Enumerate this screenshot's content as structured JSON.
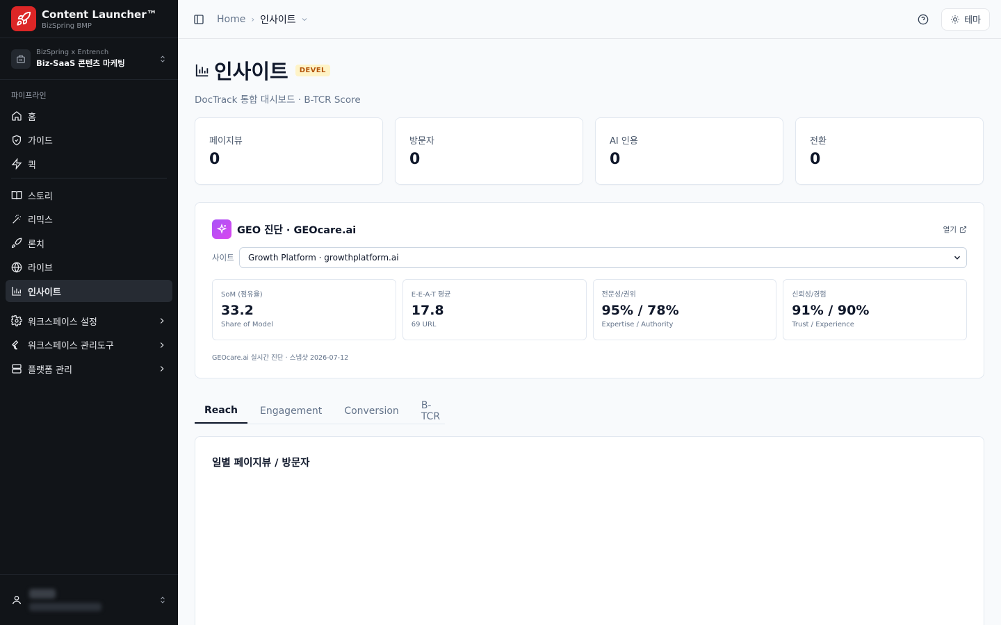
{
  "brand": {
    "title": "Content Launcher™",
    "subtitle": "BizSpring BMP"
  },
  "workspace": {
    "top": "BizSpring x Entrench",
    "name": "Biz-SaaS 콘텐츠 마케팅"
  },
  "sidebar": {
    "group_label": "파이프라인",
    "items": [
      {
        "label": "홈",
        "icon": "home-icon"
      },
      {
        "label": "가이드",
        "icon": "shield-icon"
      },
      {
        "label": "퀵",
        "icon": "zap-icon"
      },
      {
        "label": "스토리",
        "icon": "book-icon"
      },
      {
        "label": "리믹스",
        "icon": "wand-icon"
      },
      {
        "label": "론치",
        "icon": "rocket-icon"
      },
      {
        "label": "라이브",
        "icon": "globe-icon"
      },
      {
        "label": "인사이트",
        "icon": "bar-chart-icon",
        "active": true
      },
      {
        "label": "워크스페이스 설정",
        "icon": "gear-icon"
      },
      {
        "label": "워크스페이스 관리도구",
        "icon": "wrench-icon"
      },
      {
        "label": "플랫폼 관리",
        "icon": "server-icon"
      }
    ]
  },
  "topbar": {
    "home": "Home",
    "current": "인사이트",
    "theme_label": "테마"
  },
  "page": {
    "title": "인사이트",
    "badge": "DEVEL",
    "subtitle": "DocTrack 통합 대시보드 · B-TCR Score"
  },
  "stats": [
    {
      "label": "페이지뷰",
      "value": "0"
    },
    {
      "label": "방문자",
      "value": "0"
    },
    {
      "label": "AI 인용",
      "value": "0"
    },
    {
      "label": "전환",
      "value": "0"
    }
  ],
  "geo": {
    "title": "GEO 진단 · GEOcare.ai",
    "open_label": "열기",
    "site_label": "사이트",
    "site_value": "Growth Platform · growthplatform.ai",
    "metrics": [
      {
        "label": "SoM (점유율)",
        "value": "33.2",
        "sub": "Share of Model"
      },
      {
        "label": "E-E-A-T 평균",
        "value": "17.8",
        "sub": "69 URL"
      },
      {
        "label": "전문성/권위",
        "value": "95% / 78%",
        "sub": "Expertise / Authority"
      },
      {
        "label": "신뢰성/경험",
        "value": "91% / 90%",
        "sub": "Trust / Experience"
      }
    ],
    "footer": "GEOcare.ai 실시간 진단 · 스냅샷 2026-07-12"
  },
  "tabs": [
    "Reach",
    "Engagement",
    "Conversion",
    "B-TCR"
  ],
  "chart": {
    "title": "일별 페이지뷰 / 방문자"
  },
  "colors": {
    "sidebar_bg": "#111418",
    "brand_red": "#dc2626",
    "accent_purple": "#a855f7",
    "badge_bg": "#fef3c7",
    "badge_text": "#b45309"
  }
}
